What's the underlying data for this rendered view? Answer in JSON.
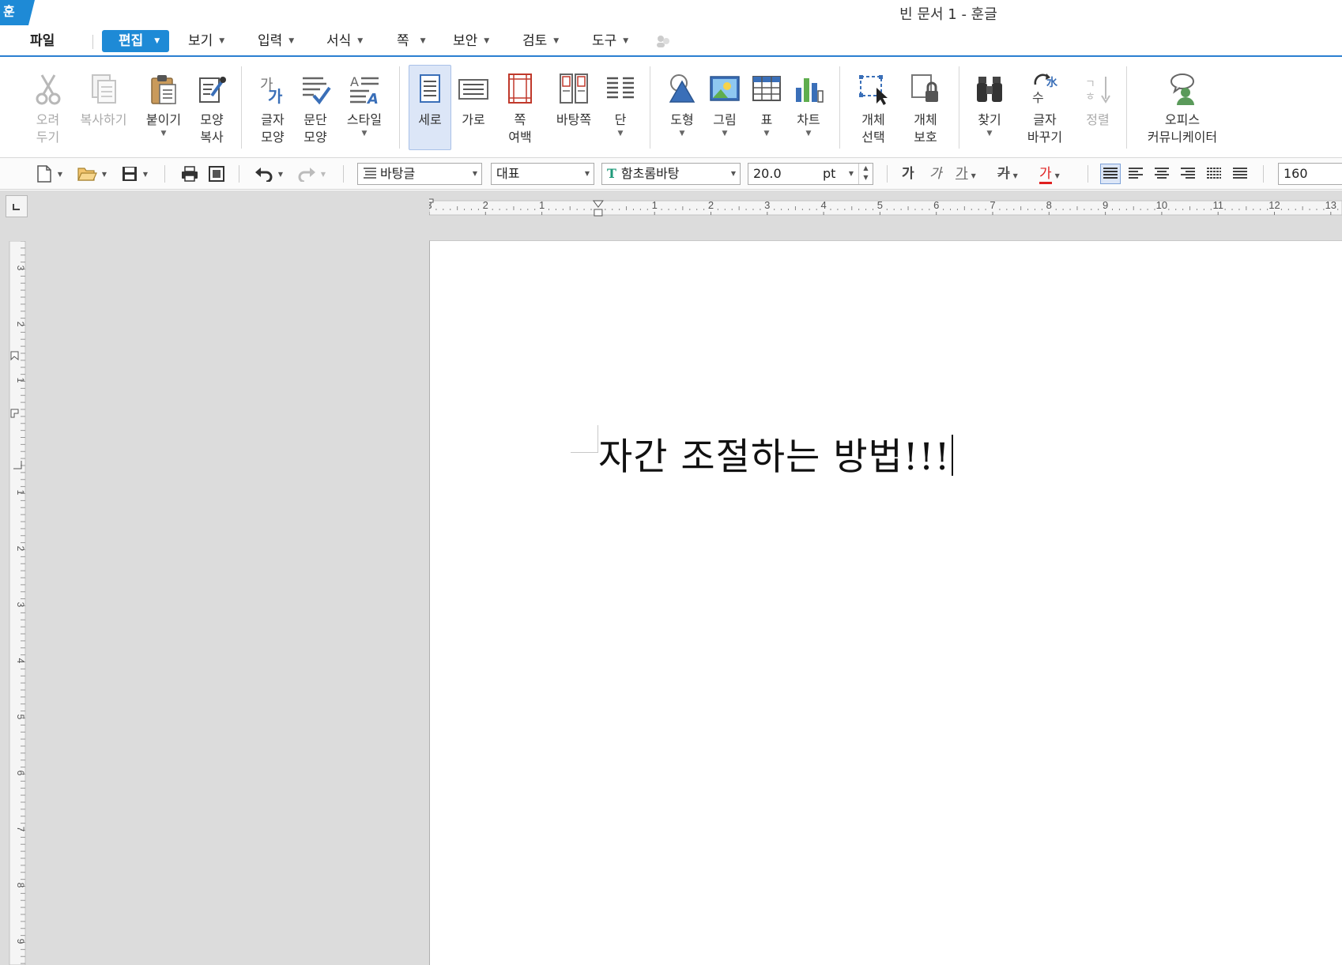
{
  "app": {
    "logo_glyph": "훈",
    "window_title": "빈 문서 1 - 훈글",
    "brand_color": "#1e8ad6"
  },
  "menus": {
    "file": "파일",
    "edit": "편집",
    "view": "보기",
    "insert": "입력",
    "format": "서식",
    "page": "쪽",
    "security": "보안",
    "review": "검토",
    "tools": "도구"
  },
  "ribbon": {
    "cut": "오려\n두기",
    "copy": "복사하기",
    "paste": "붙이기",
    "format_copy": "모양\n복사",
    "char_shape": "글자\n모양",
    "para_shape": "문단\n모양",
    "style": "스타일",
    "portrait": "세로",
    "landscape": "가로",
    "page_margin": "쪽\n여백",
    "master_page": "바탕쪽",
    "columns": "단",
    "shape": "도형",
    "picture": "그림",
    "table": "표",
    "chart": "차트",
    "select_object": "개체\n선택",
    "protect_object": "개체\n보호",
    "find": "찾기",
    "replace": "글자\n바꾸기",
    "sort": "정렬",
    "office_communicator": "오피스\n커뮤니케이터"
  },
  "toolbar": {
    "style_value": "바탕글",
    "language_value": "대표",
    "font_value": "함초롬바탕",
    "font_size_value": "20.0",
    "font_size_unit": "pt",
    "bold_glyph": "가",
    "italic_glyph": "가",
    "underline_glyph": "가",
    "strike_glyph": "가",
    "color_glyph": "가",
    "font_color": "#e02020",
    "zoom_value": "160"
  },
  "ruler": {
    "h_labels": [
      "3",
      "2",
      "1",
      "",
      "1",
      "2",
      "3",
      "4",
      "5",
      "6",
      "7",
      "8",
      "9",
      "10",
      "11",
      "12",
      "13"
    ],
    "v_labels": [
      "3",
      "2",
      "1",
      "1",
      "2",
      "3",
      "4",
      "5",
      "6",
      "7",
      "8",
      "9"
    ]
  },
  "document": {
    "text": "자간  조절하는  방법!!!"
  }
}
